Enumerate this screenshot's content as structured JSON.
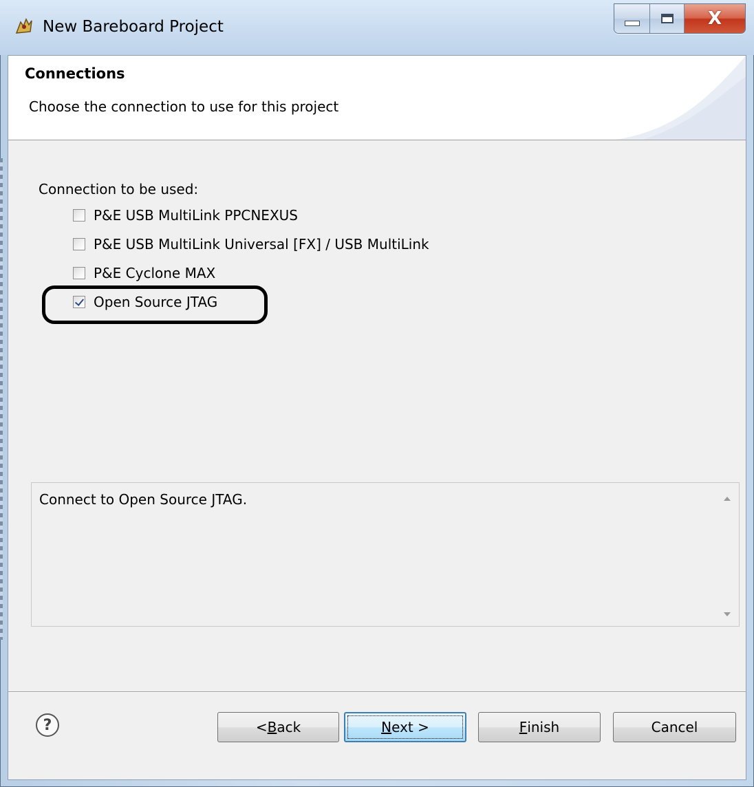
{
  "window": {
    "title": "New Bareboard Project",
    "minimize_label": "",
    "maximize_label": "",
    "close_label": "X"
  },
  "header": {
    "title": "Connections",
    "description": "Choose the connection to use for this project"
  },
  "connections": {
    "label": "Connection to be used:",
    "options": [
      {
        "label": "P&E USB MultiLink PPCNEXUS",
        "checked": false
      },
      {
        "label": "P&E USB MultiLink Universal [FX] / USB MultiLink",
        "checked": false
      },
      {
        "label": "P&E Cyclone MAX",
        "checked": false
      },
      {
        "label": "Open Source JTAG",
        "checked": true
      }
    ]
  },
  "description_box": {
    "text": "Connect to Open Source JTAG."
  },
  "footer": {
    "help_symbol": "?",
    "back": {
      "pre": "< ",
      "mnemonic": "B",
      "post": "ack"
    },
    "next": {
      "pre": "",
      "mnemonic": "N",
      "post": "ext >"
    },
    "finish": {
      "pre": "",
      "mnemonic": "F",
      "post": "inish"
    },
    "cancel": "Cancel"
  },
  "colors": {
    "highlight_ring": "#000000",
    "default_button_border": "#3c7fb1",
    "close_button": "#c2361c"
  }
}
